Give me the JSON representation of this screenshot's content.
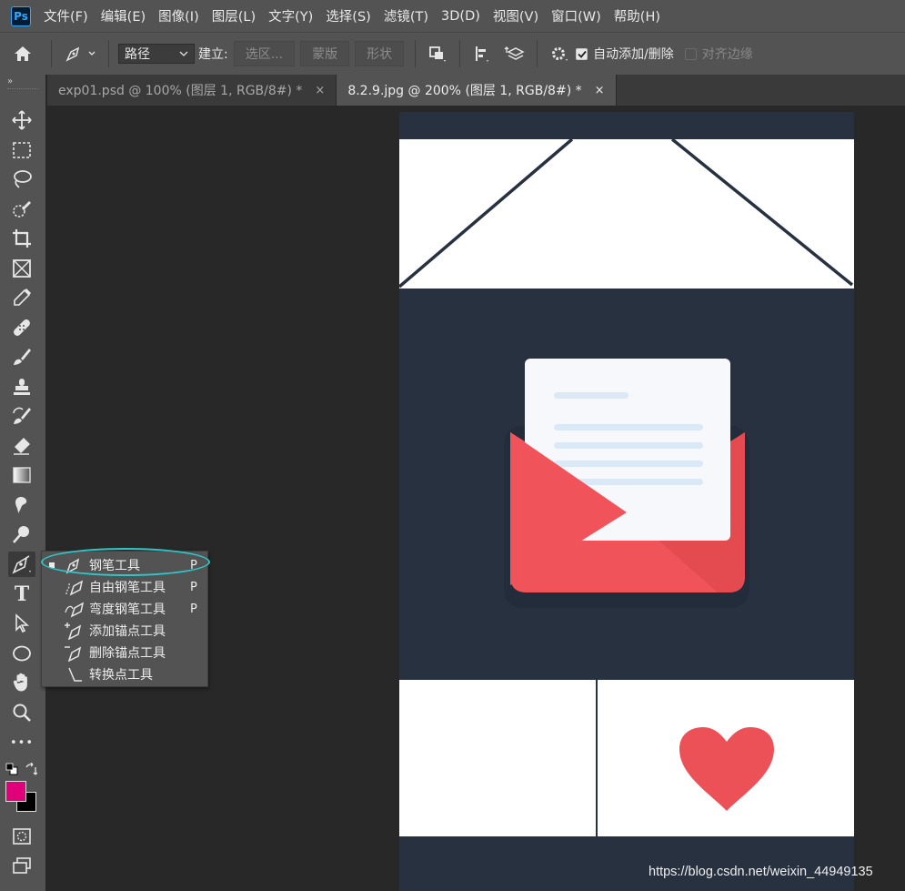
{
  "app": {
    "logo_text": "Ps"
  },
  "menu": [
    "文件(F)",
    "编辑(E)",
    "图像(I)",
    "图层(L)",
    "文字(Y)",
    "选择(S)",
    "滤镜(T)",
    "3D(D)",
    "视图(V)",
    "窗口(W)",
    "帮助(H)"
  ],
  "options": {
    "mode_value": "路径",
    "make_label": "建立:",
    "selection_btn": "选区...",
    "mask_btn": "蒙版",
    "shape_btn": "形状",
    "auto_add_delete": "自动添加/删除",
    "auto_add_delete_checked": true,
    "align_edges": "对齐边缘",
    "align_edges_checked": false
  },
  "tabs": [
    {
      "label": "exp01.psd @ 100% (图层 1, RGB/8#) *",
      "close": "×",
      "active": false
    },
    {
      "label": "8.2.9.jpg @ 200% (图层 1, RGB/8#) *",
      "close": "×",
      "active": true
    }
  ],
  "toolbar_tools": [
    "move-icon",
    "marquee-icon",
    "lasso-icon",
    "quick-select-icon",
    "crop-icon",
    "frame-icon",
    "eyedropper-icon",
    "healing-icon",
    "brush-icon",
    "stamp-icon",
    "history-brush-icon",
    "eraser-icon",
    "gradient-icon",
    "smudge-icon",
    "dodge-icon",
    "pen-icon",
    "type-icon",
    "path-select-icon",
    "ellipse-icon",
    "hand-icon",
    "zoom-icon",
    "more-icon"
  ],
  "toolbar_type_glyph": "T",
  "toolbar_more_glyph": "•••",
  "flyout": [
    {
      "label": "钢笔工具",
      "key": "P",
      "selected": true
    },
    {
      "label": "自由钢笔工具",
      "key": "P",
      "selected": false
    },
    {
      "label": "弯度钢笔工具",
      "key": "P",
      "selected": false
    },
    {
      "label": "添加锚点工具",
      "key": "",
      "selected": false
    },
    {
      "label": "删除锚点工具",
      "key": "",
      "selected": false
    },
    {
      "label": "转换点工具",
      "key": "",
      "selected": false
    }
  ],
  "colors": {
    "foreground": "#e0007a",
    "background": "#000000",
    "canvas_bg": "#273140",
    "envelope_red": "#f0545a",
    "heart_red": "#ec5157",
    "highlight_ring": "#2fc6c9"
  },
  "watermark": "https://blog.csdn.net/weixin_44949135"
}
